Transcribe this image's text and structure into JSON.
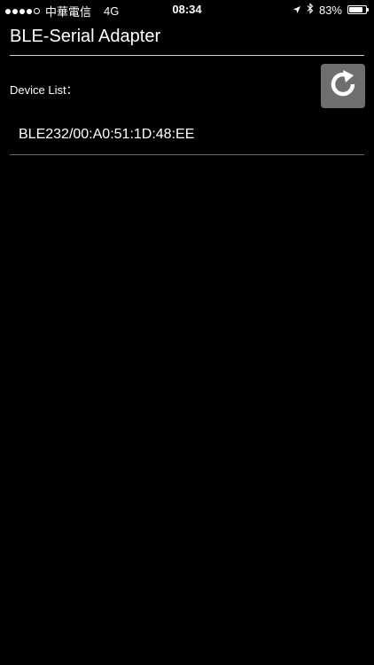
{
  "status_bar": {
    "carrier": "中華電信",
    "network": "4G",
    "time": "08:34",
    "battery_percent": "83%",
    "battery_level": 0.83,
    "signal_bars_filled": 4,
    "signal_bars_total": 5
  },
  "header": {
    "title": "BLE-Serial Adapter"
  },
  "device_list": {
    "label": "Device List：",
    "refresh_icon": "refresh-icon",
    "devices": [
      {
        "name": "BLE232/00:A0:51:1D:48:EE"
      }
    ]
  }
}
